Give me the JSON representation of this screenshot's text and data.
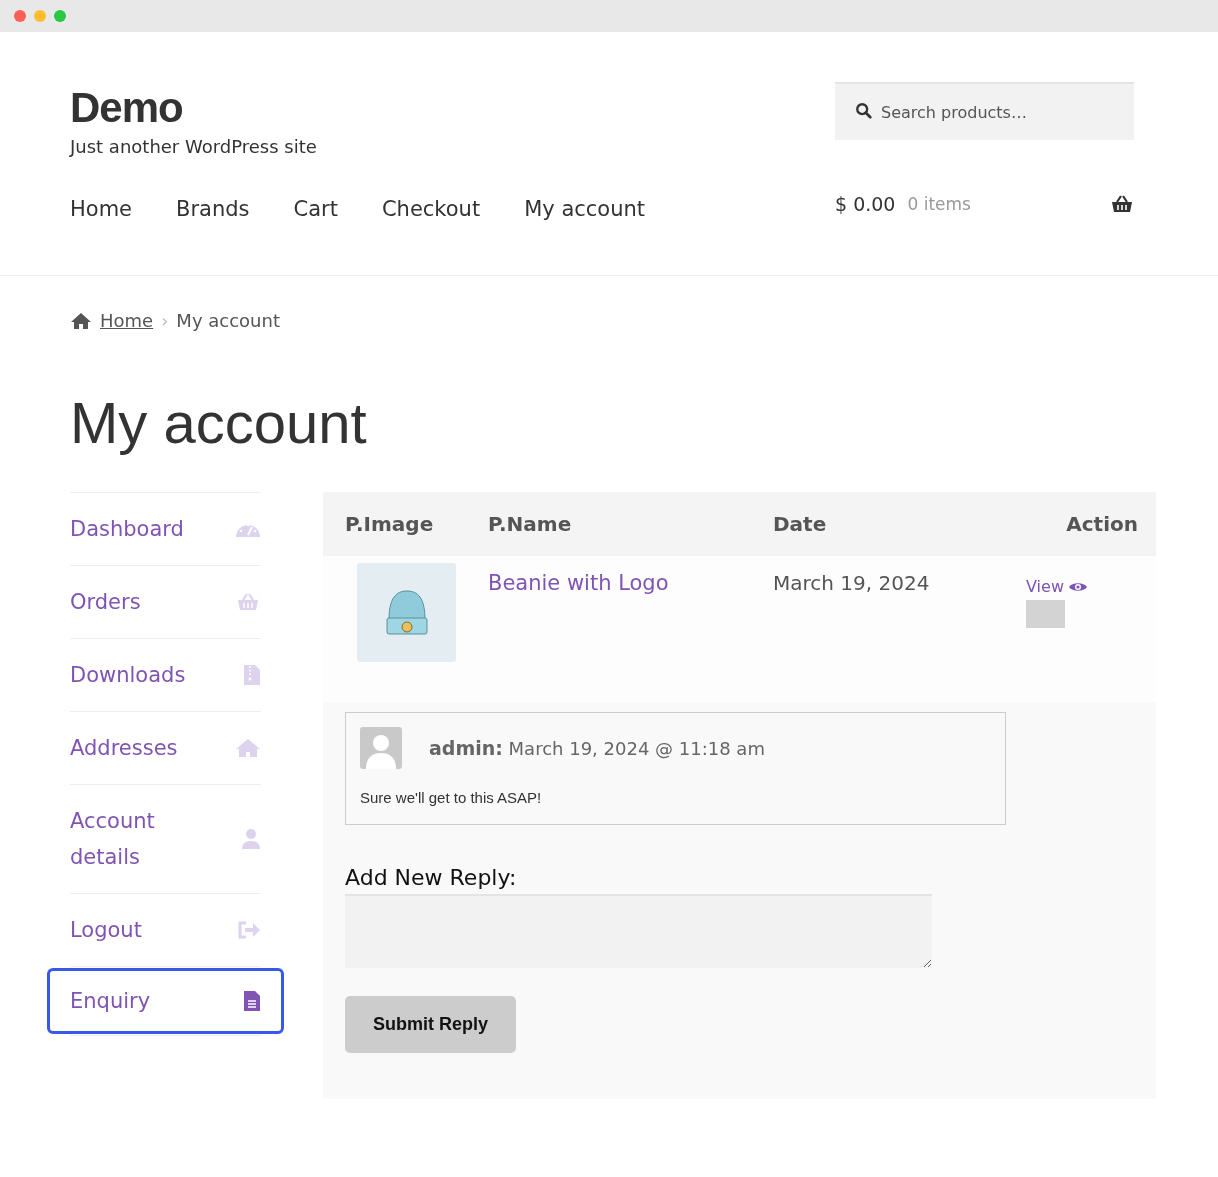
{
  "site": {
    "title": "Demo",
    "tagline": "Just another WordPress site"
  },
  "search": {
    "placeholder": "Search products…"
  },
  "nav": [
    "Home",
    "Brands",
    "Cart",
    "Checkout",
    "My account"
  ],
  "cart": {
    "total": "$ 0.00",
    "count": "0 items"
  },
  "breadcrumb": {
    "home": "Home",
    "separator": "›",
    "current": "My account"
  },
  "page_title": "My account",
  "sidebar": {
    "items": [
      {
        "label": "Dashboard",
        "selected": false
      },
      {
        "label": "Orders",
        "selected": false
      },
      {
        "label": "Downloads",
        "selected": false
      },
      {
        "label": "Addresses",
        "selected": false
      },
      {
        "label": "Account details",
        "selected": false
      },
      {
        "label": "Logout",
        "selected": false
      },
      {
        "label": "Enquiry",
        "selected": true
      }
    ]
  },
  "table": {
    "columns": [
      "P.Image",
      "P.Name",
      "Date",
      "Action"
    ],
    "rows": [
      {
        "name": "Beanie with Logo",
        "date": "March 19, 2024",
        "action": "View"
      }
    ]
  },
  "comment": {
    "author": "admin:",
    "date": "March 19, 2024 @ 11:18 am",
    "text": "Sure we'll get to this ASAP!"
  },
  "reply": {
    "label": "Add New Reply:",
    "button": "Submit Reply"
  }
}
